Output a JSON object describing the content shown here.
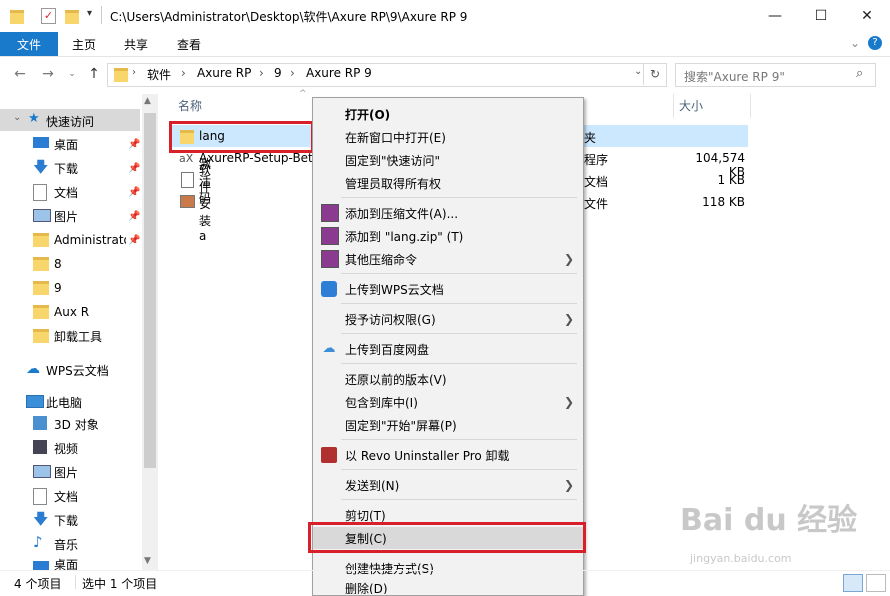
{
  "window": {
    "title": "C:\\Users\\Administrator\\Desktop\\软件\\Axure RP\\9\\Axure RP 9",
    "minimize": "—",
    "maximize": "☐",
    "close": "✕"
  },
  "ribbon": {
    "tabs": [
      "文件",
      "主页",
      "共享",
      "查看"
    ],
    "collapse": "⌄",
    "help": "?"
  },
  "address": {
    "crumbs": [
      "软件",
      "Axure RP",
      "9",
      "Axure RP 9"
    ],
    "search_placeholder": "搜索\"Axure RP 9\""
  },
  "nav": {
    "quick_access": "快速访问",
    "items": [
      {
        "label": "桌面",
        "icon": "desktop-icon",
        "pinned": true
      },
      {
        "label": "下载",
        "icon": "download-icon",
        "pinned": true
      },
      {
        "label": "文档",
        "icon": "document-icon",
        "pinned": true
      },
      {
        "label": "图片",
        "icon": "picture-icon",
        "pinned": true
      },
      {
        "label": "Administrato",
        "icon": "folder-icon",
        "pinned": true
      },
      {
        "label": "8",
        "icon": "folder-icon",
        "pinned": false
      },
      {
        "label": "9",
        "icon": "folder-icon",
        "pinned": false
      },
      {
        "label": "Aux R",
        "icon": "folder-icon",
        "pinned": false
      },
      {
        "label": "卸载工具",
        "icon": "folder-icon",
        "pinned": false
      }
    ],
    "wps": "WPS云文档",
    "this_pc": "此电脑",
    "pc_items": [
      {
        "label": "3D 对象",
        "icon": "3d-icon"
      },
      {
        "label": "视频",
        "icon": "video-icon"
      },
      {
        "label": "图片",
        "icon": "picture-icon"
      },
      {
        "label": "文档",
        "icon": "document-icon"
      },
      {
        "label": "下载",
        "icon": "download-icon"
      },
      {
        "label": "音乐",
        "icon": "music-icon"
      },
      {
        "label": "桌面",
        "icon": "desktop-icon"
      }
    ]
  },
  "files": {
    "col_name": "名称",
    "col_size": "大小",
    "rows": [
      {
        "name": "lang",
        "type": "夹",
        "size": ""
      },
      {
        "name": "AxureRP-Setup-Bet",
        "type": "程序",
        "size": "104,574 KB"
      },
      {
        "name": "激活码",
        "type": "文档",
        "size": "1 KB"
      },
      {
        "name": "软件安装a",
        "type": "文件",
        "size": "118 KB"
      }
    ]
  },
  "context_menu": {
    "items": [
      {
        "label": "打开(O)",
        "bold": true,
        "icon": ""
      },
      {
        "label": "在新窗口中打开(E)",
        "icon": ""
      },
      {
        "label": "固定到\"快速访问\"",
        "icon": ""
      },
      {
        "label": "管理员取得所有权",
        "icon": ""
      },
      {
        "label": "添加到压缩文件(A)...",
        "icon": "winrar-icon"
      },
      {
        "label": "添加到 \"lang.zip\" (T)",
        "icon": "winrar-icon"
      },
      {
        "label": "其他压缩命令",
        "icon": "winrar-icon",
        "submenu": true
      },
      {
        "label": "上传到WPS云文档",
        "icon": "wps-cloud-icon"
      },
      {
        "label": "授予访问权限(G)",
        "icon": "",
        "submenu": true
      },
      {
        "label": "上传到百度网盘",
        "icon": "baidu-netdisk-icon"
      },
      {
        "label": "还原以前的版本(V)",
        "icon": ""
      },
      {
        "label": "包含到库中(I)",
        "icon": "",
        "submenu": true
      },
      {
        "label": "固定到\"开始\"屏幕(P)",
        "icon": ""
      },
      {
        "label": "以 Revo Uninstaller Pro 卸载",
        "icon": "revo-icon"
      },
      {
        "label": "发送到(N)",
        "icon": "",
        "submenu": true
      },
      {
        "label": "剪切(T)",
        "icon": ""
      },
      {
        "label": "复制(C)",
        "icon": ""
      },
      {
        "label": "创建快捷方式(S)",
        "icon": ""
      },
      {
        "label": "删除(D)",
        "icon": ""
      }
    ]
  },
  "status": {
    "count": "4 个项目",
    "selected": "选中 1 个项目"
  },
  "watermark": {
    "logo": "Bai du 经验",
    "url": "jingyan.baidu.com"
  },
  "colors": {
    "accent": "#1979ca",
    "highlight_box": "#d8202a",
    "selection": "#cce8ff"
  }
}
